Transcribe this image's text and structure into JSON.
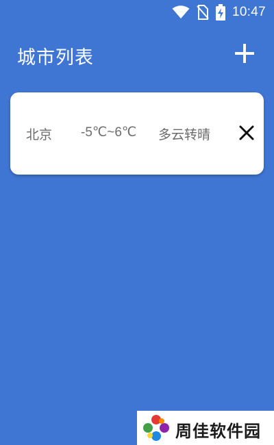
{
  "status_bar": {
    "time": "10:47",
    "icons": [
      "wifi-icon",
      "no-sim-icon",
      "battery-charging-icon"
    ]
  },
  "header": {
    "title": "城市列表",
    "add_icon": "plus-icon"
  },
  "cities": [
    {
      "name": "北京",
      "temperature": "-5℃~6℃",
      "weather": "多云转晴",
      "delete_icon": "close-icon"
    }
  ],
  "watermark": {
    "text": "周佳软件园"
  },
  "colors": {
    "background": "#3f76d3",
    "card": "#ffffff",
    "card_text": "#6b6b6b",
    "header_text": "#ffffff"
  }
}
